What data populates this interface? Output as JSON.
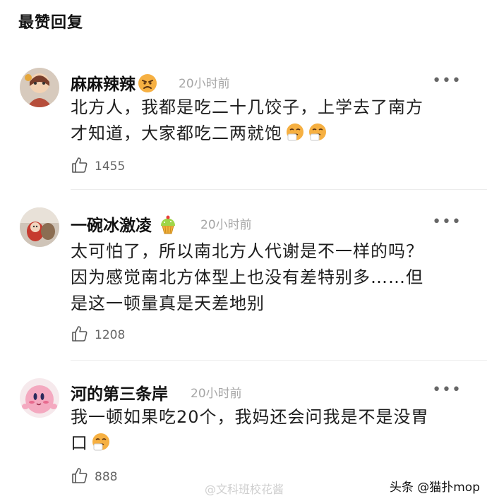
{
  "section": {
    "title": "最赞回复"
  },
  "comments": [
    {
      "author": "麻麻辣辣",
      "author_emoji": "angry-face",
      "time": "20小时前",
      "more": "•••",
      "text_lines": [
        "北方人，我都是吃二十几饺子，上学去了南方",
        "才知道，大家都吃二两就饱"
      ],
      "trailing_emoji": [
        "sneezing-face",
        "sneezing-face"
      ],
      "likes": "1455"
    },
    {
      "author": "一碗冰激凌",
      "author_emoji": "cupcake",
      "time": "20小时前",
      "more": "•••",
      "text_lines": [
        "太可怕了，所以南北方人代谢是不一样的吗？",
        "因为感觉南北方体型上也没有差特别多……但",
        "是这一顿量真是天差地别"
      ],
      "likes": "1208"
    },
    {
      "author": "河的第三条岸",
      "time": "20小时前",
      "more": "•••",
      "text_lines": [
        "我一顿如果吃20个，我妈还会问我是不是没胃",
        "口"
      ],
      "trailing_emoji": [
        "sneezing-face"
      ],
      "likes": "888"
    }
  ],
  "watermark": {
    "text": "@文科班校花酱"
  },
  "source_tag": {
    "text": "头条 @猫扑mop"
  }
}
